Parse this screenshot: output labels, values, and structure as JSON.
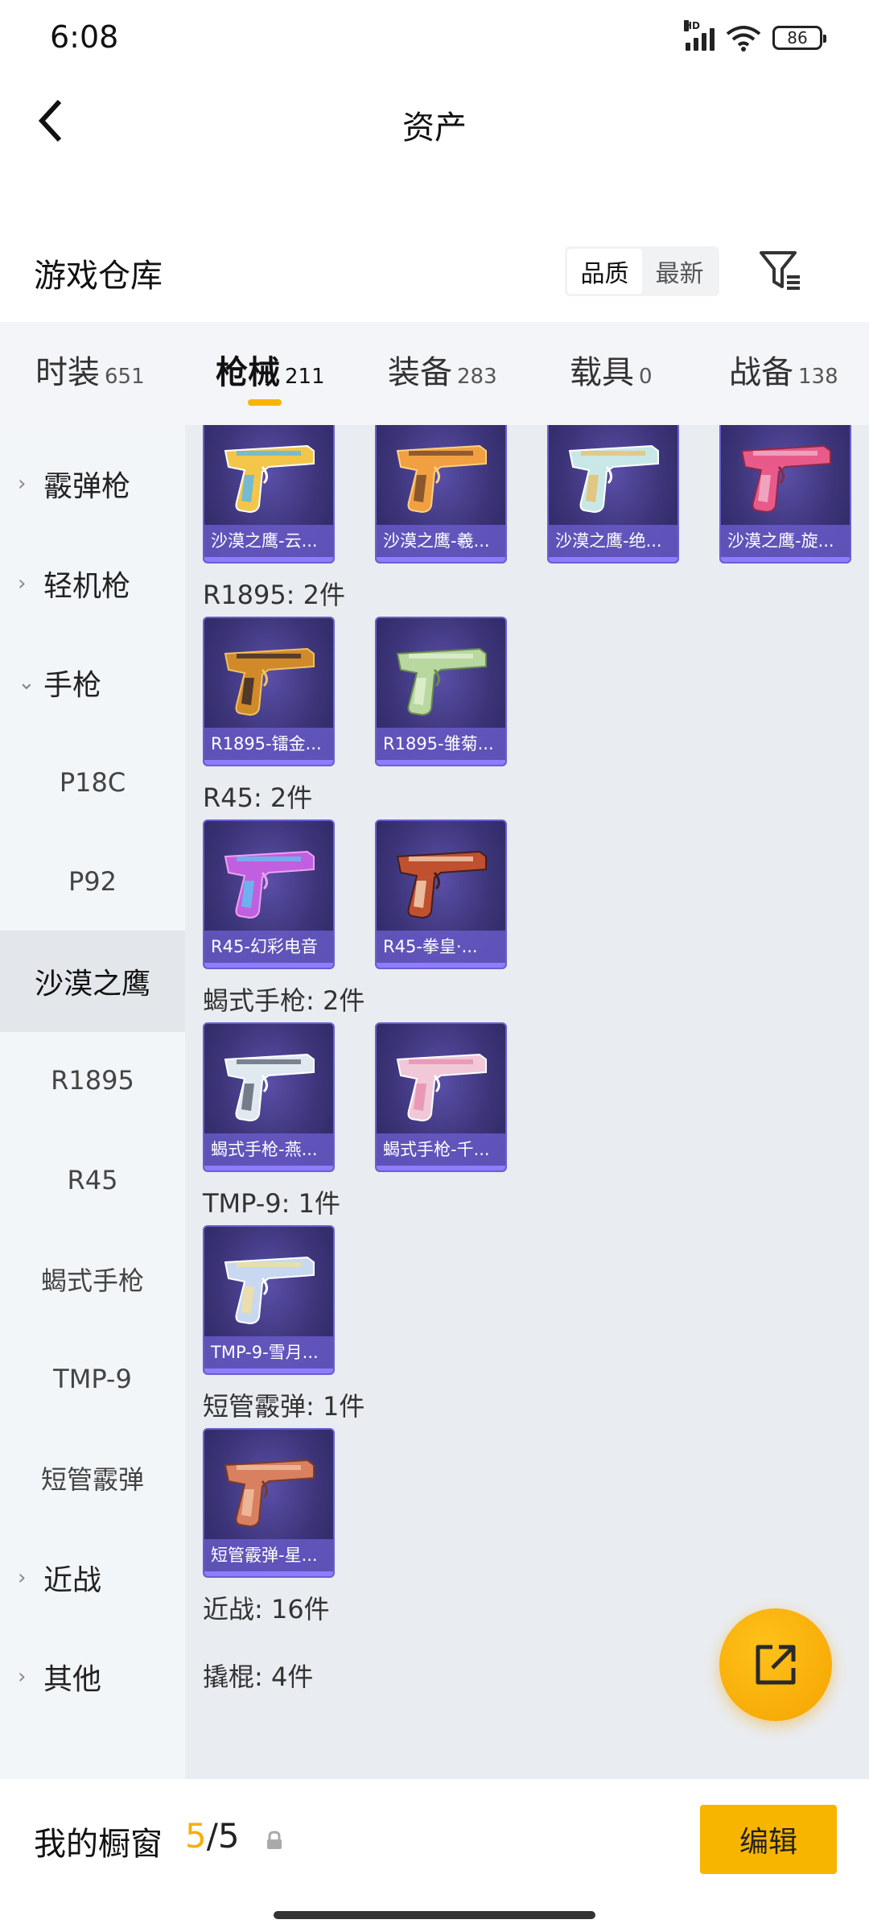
{
  "status_bar": {
    "time": "6:08",
    "network": "HD",
    "battery": "86",
    "icons": [
      "signal-icon",
      "wifi-icon",
      "battery-icon"
    ]
  },
  "header": {
    "back_icon": "chevron-left-icon",
    "title": "资产"
  },
  "warehouse": {
    "title": "游戏仓库",
    "sort_options": [
      {
        "label": "品质",
        "active": true
      },
      {
        "label": "最新",
        "active": false
      }
    ],
    "filter_icon": "filter-icon"
  },
  "tabs": [
    {
      "label": "时装",
      "count": "651",
      "active": false
    },
    {
      "label": "枪械",
      "count": "211",
      "active": true
    },
    {
      "label": "装备",
      "count": "283",
      "active": false
    },
    {
      "label": "载具",
      "count": "0",
      "active": false
    },
    {
      "label": "战备",
      "count": "138",
      "active": false
    }
  ],
  "sidebar": [
    {
      "label": "霰弹枪",
      "type": "group",
      "expanded": false
    },
    {
      "label": "轻机枪",
      "type": "group",
      "expanded": false
    },
    {
      "label": "手枪",
      "type": "group",
      "expanded": true
    },
    {
      "label": "P18C",
      "type": "sub"
    },
    {
      "label": "P92",
      "type": "sub"
    },
    {
      "label": "沙漠之鹰",
      "type": "sub",
      "selected": true
    },
    {
      "label": "R1895",
      "type": "sub"
    },
    {
      "label": "R45",
      "type": "sub"
    },
    {
      "label": "蝎式手枪",
      "type": "sub"
    },
    {
      "label": "TMP-9",
      "type": "sub"
    },
    {
      "label": "短管霰弹",
      "type": "sub"
    },
    {
      "label": "近战",
      "type": "group",
      "expanded": false
    },
    {
      "label": "其他",
      "type": "group",
      "expanded": false
    }
  ],
  "sections": [
    {
      "label": "",
      "items": [
        {
          "name": "沙漠之鹰-云...",
          "palette": [
            "#f3c64a",
            "#5ab8e8",
            "#ffffff"
          ]
        },
        {
          "name": "沙漠之鹰-羲...",
          "palette": [
            "#f0a040",
            "#7a4a2a",
            "#ffd080"
          ]
        },
        {
          "name": "沙漠之鹰-绝...",
          "palette": [
            "#c8e8e8",
            "#e8c070",
            "#ffffff"
          ]
        },
        {
          "name": "沙漠之鹰-旋...",
          "palette": [
            "#e85a8a",
            "#f0b0c8",
            "#8a2a4a"
          ]
        }
      ]
    },
    {
      "label": "R1895: 2件",
      "items": [
        {
          "name": "R1895-镭金...",
          "palette": [
            "#d08a2a",
            "#3a2a2a",
            "#f0c060"
          ]
        },
        {
          "name": "R1895-雏菊...",
          "palette": [
            "#b8d8a0",
            "#e0f0d0",
            "#6a8a50"
          ]
        }
      ]
    },
    {
      "label": "R45: 2件",
      "items": [
        {
          "name": "R45-幻彩电音",
          "palette": [
            "#c060e0",
            "#60c0f0",
            "#f0a0f0"
          ]
        },
        {
          "name": "R45-拳皇·...",
          "palette": [
            "#c05030",
            "#f0d0b0",
            "#402020"
          ]
        }
      ]
    },
    {
      "label": "蝎式手枪: 2件",
      "items": [
        {
          "name": "蝎式手枪-燕...",
          "palette": [
            "#e0e8f0",
            "#606878",
            "#ffffff"
          ]
        },
        {
          "name": "蝎式手枪-千...",
          "palette": [
            "#f0c8d8",
            "#e890b0",
            "#ffffff"
          ]
        }
      ]
    },
    {
      "label": "TMP-9: 1件",
      "items": [
        {
          "name": "TMP-9-雪月...",
          "palette": [
            "#c8d8f0",
            "#f0e0a0",
            "#ffffff"
          ]
        }
      ]
    },
    {
      "label": "短管霰弹: 1件",
      "items": [
        {
          "name": "短管霰弹-星...",
          "palette": [
            "#d88060",
            "#f0c0a0",
            "#7a3a2a"
          ]
        }
      ]
    },
    {
      "label": "近战: 16件",
      "items": []
    },
    {
      "label": "撬棍: 4件",
      "items": []
    }
  ],
  "fab": {
    "icon": "share-external-icon"
  },
  "bottom_bar": {
    "title": "我的橱窗",
    "count_current": "5",
    "count_sep": "/",
    "count_total": "5",
    "lock_icon": "lock-icon",
    "edit_label": "编辑"
  },
  "colors": {
    "accent": "#f7b500",
    "card_bg": "#3c3478",
    "card_label_bg": "#6e60d2"
  }
}
